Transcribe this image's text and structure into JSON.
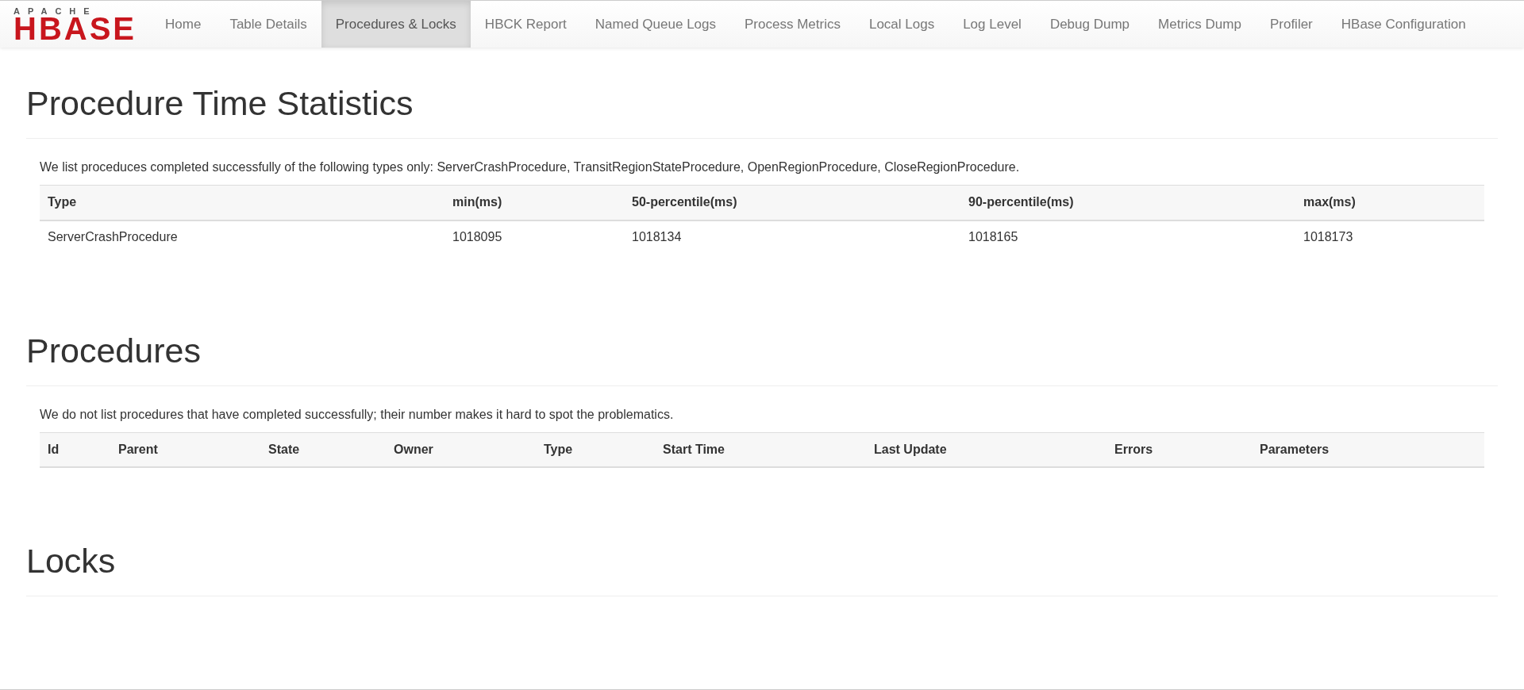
{
  "logo": {
    "top": "APACHE",
    "main": "HBASE"
  },
  "nav": [
    {
      "label": "Home",
      "selected": false
    },
    {
      "label": "Table Details",
      "selected": false
    },
    {
      "label": "Procedures & Locks",
      "selected": true
    },
    {
      "label": "HBCK Report",
      "selected": false
    },
    {
      "label": "Named Queue Logs",
      "selected": false
    },
    {
      "label": "Process Metrics",
      "selected": false
    },
    {
      "label": "Local Logs",
      "selected": false
    },
    {
      "label": "Log Level",
      "selected": false
    },
    {
      "label": "Debug Dump",
      "selected": false
    },
    {
      "label": "Metrics Dump",
      "selected": false
    },
    {
      "label": "Profiler",
      "selected": false
    },
    {
      "label": "HBase Configuration",
      "selected": false
    }
  ],
  "sections": [
    {
      "title": "Procedure Time Statistics",
      "note": "We list proceduces completed successfully of the following types only: ServerCrashProcedure, TransitRegionStateProcedure, OpenRegionProcedure, CloseRegionProcedure.",
      "table": {
        "columns": [
          "Type",
          "min(ms)",
          "50-percentile(ms)",
          "90-percentile(ms)",
          "max(ms)"
        ],
        "rows": [
          [
            "ServerCrashProcedure",
            "1018095",
            "1018134",
            "1018165",
            "1018173"
          ]
        ]
      }
    },
    {
      "title": "Procedures",
      "note": "We do not list procedures that have completed successfully; their number makes it hard to spot the problematics.",
      "table": {
        "columns": [
          "Id",
          "Parent",
          "State",
          "Owner",
          "Type",
          "Start Time",
          "Last Update",
          "Errors",
          "Parameters"
        ]
      }
    },
    {
      "title": "Locks"
    }
  ]
}
